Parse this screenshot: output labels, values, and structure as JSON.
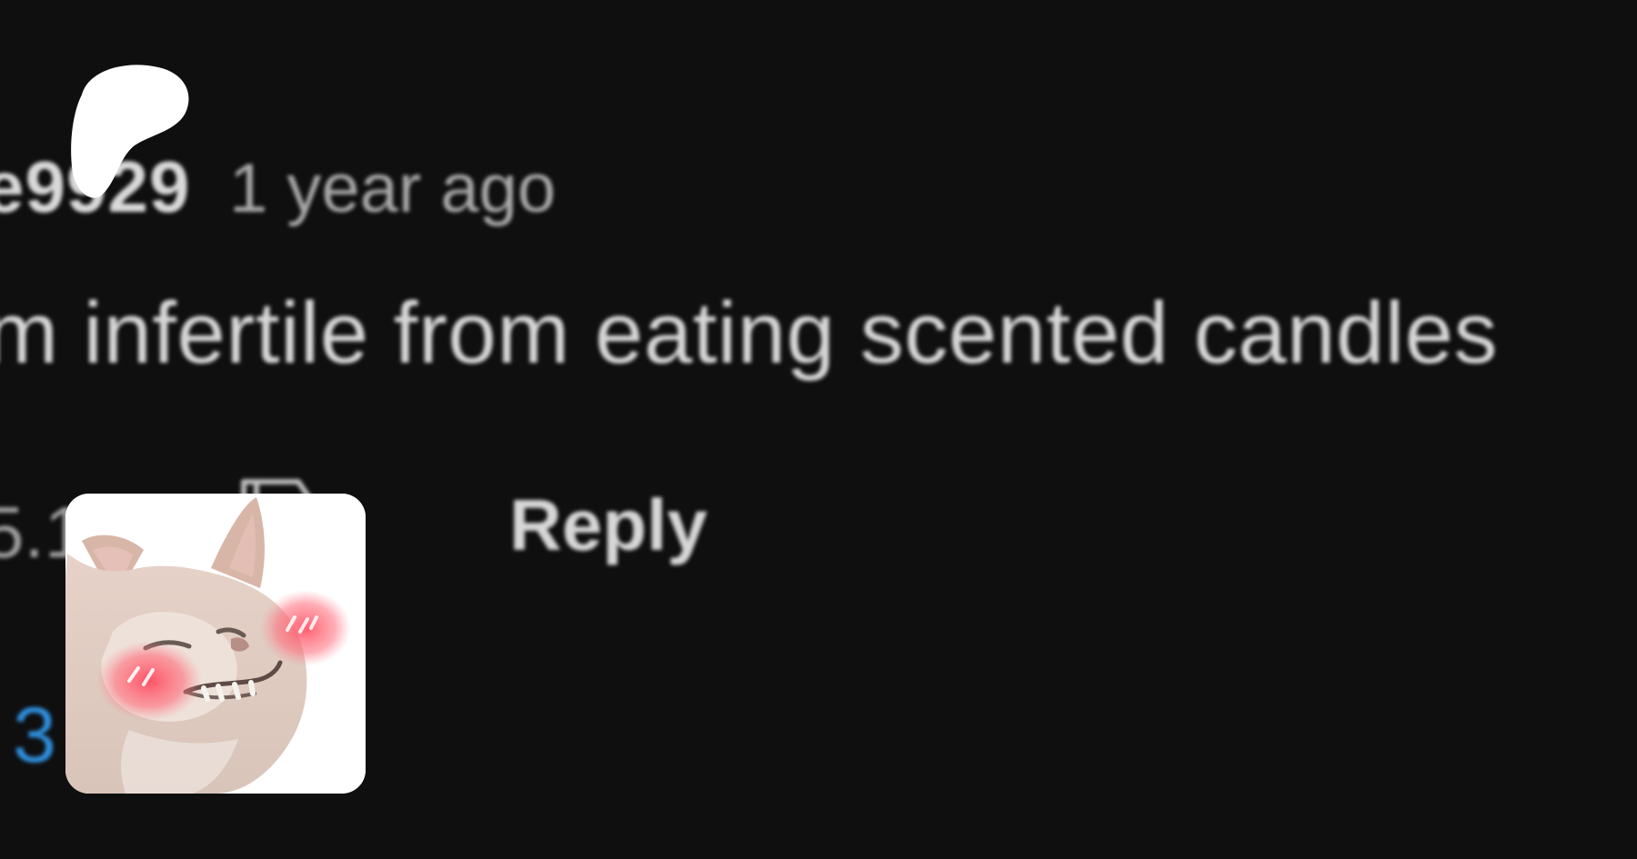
{
  "comment": {
    "author": "e9929",
    "time": "1 year ago",
    "text": "m infertile from eating scented candles",
    "likes": "5.1",
    "reply_label": "Reply",
    "view_replies_label": "3 replies"
  },
  "icons": {
    "dislike": "thumbs-down-icon",
    "overlay_shape": "blob-shape",
    "sticker": "blushing-cat-sticker"
  },
  "colors": {
    "background": "#0f0f10",
    "link": "#2f8fdd",
    "text_primary": "#d6d6d6",
    "text_secondary": "#a9a9a9"
  }
}
